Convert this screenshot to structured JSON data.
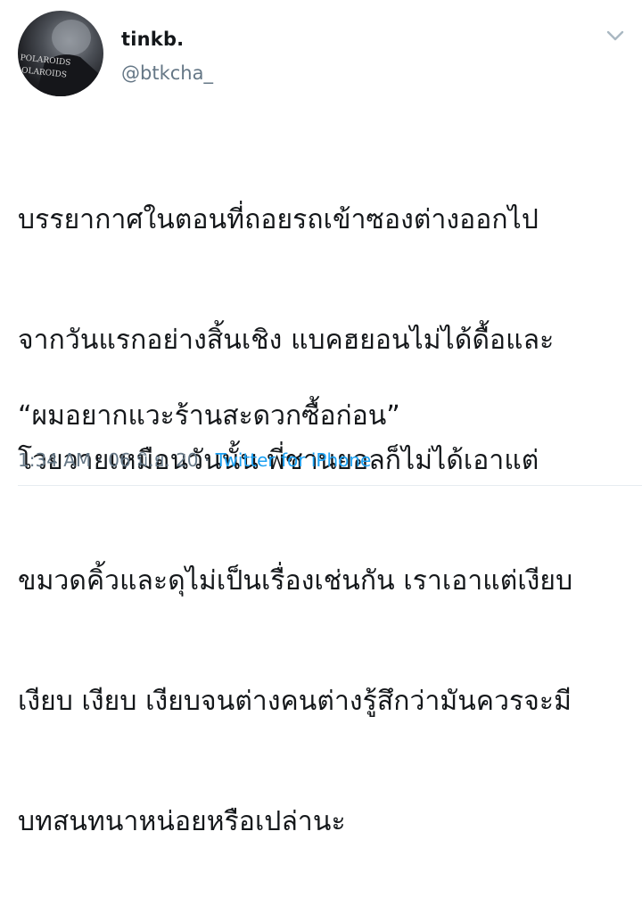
{
  "tweet": {
    "display_name": "tinkb.",
    "handle": "@btkcha_",
    "avatar_text_line1": "POLAROIDS",
    "avatar_text_line2": "OLAROIDS",
    "body_lines": [
      "บรรยากาศในตอนที่ถอยรถเข้าซองต่างออกไป",
      "จากวันแรกอย่างสิ้นเชิง แบคฮยอนไม่ได้ดื้อและ",
      "โวยวายเหมือนวันนั้น พี่ชานยอลก็ไม่ได้เอาแต่",
      "ขมวดคิ้วและดุไม่เป็นเรื่องเช่นกัน เราเอาแต่เงียบ",
      "เงียบ เงียบ เงียบจนต่างคนต่างรู้สึกว่ามันควรจะมี",
      "บทสนทนาหน่อยหรือเปล่านะ"
    ],
    "quote": "“ผมอยากแวะร้านสะดวกซื้อก่อน”",
    "time": "1:34 AM",
    "separator": "·",
    "date": "06 มิ.ย. 20",
    "source": "Twitter for iPhone"
  },
  "colors": {
    "text": "#14171a",
    "secondary": "#657786",
    "link": "#1da1f2",
    "chevron": "#aab8c2"
  },
  "icons": {
    "chevron": "chevron-down-icon"
  }
}
